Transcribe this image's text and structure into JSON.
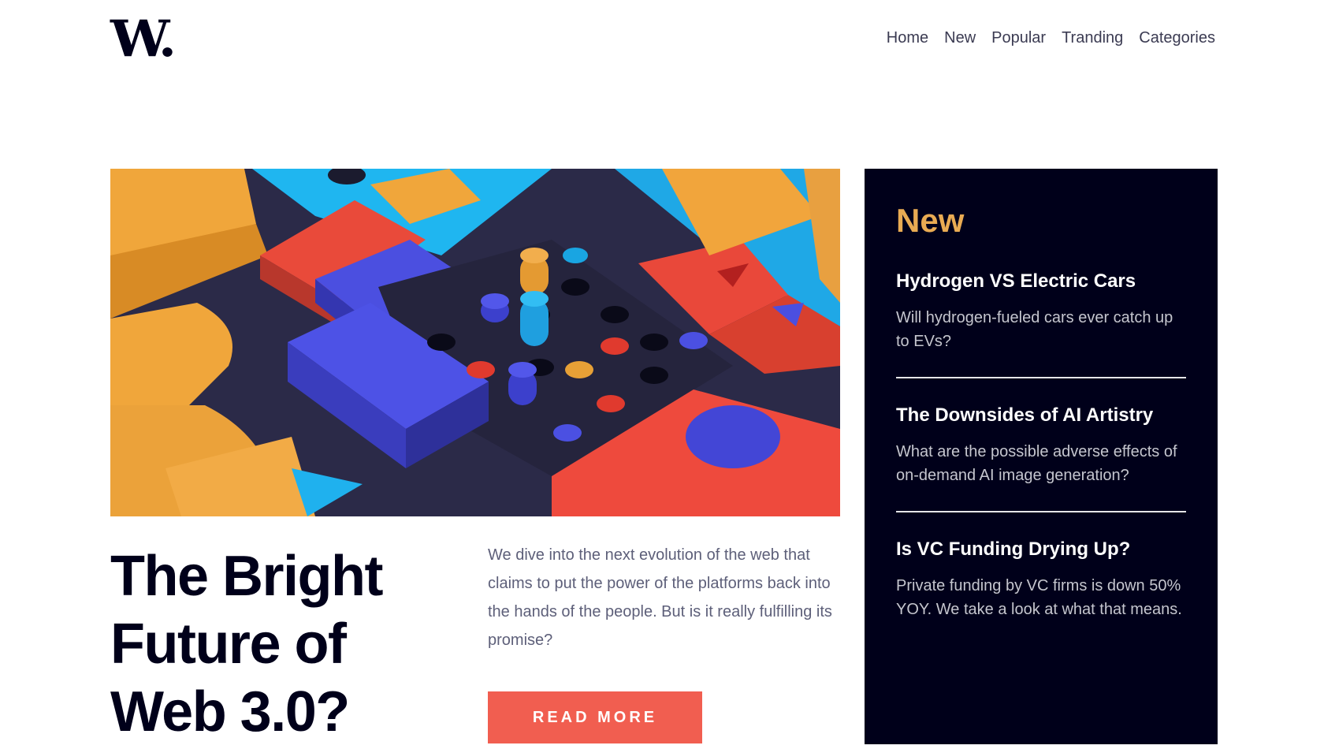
{
  "logo": "W.",
  "nav": {
    "items": [
      "Home",
      "New",
      "Popular",
      "Tranding",
      "Categories"
    ]
  },
  "hero": {
    "headline_lines": [
      "The Bright",
      "Future of",
      "Web 3.0?"
    ],
    "lead": "We dive into the next evolution of the web that claims to put the power of the platforms back into the hands of the people. But is it really fulfilling its promise?",
    "cta_label": "READ MORE"
  },
  "sidebar": {
    "title": "New",
    "items": [
      {
        "title": "Hydrogen VS Electric Cars",
        "summary": "Will hydrogen-fueled cars ever catch up to EVs?"
      },
      {
        "title": "The Downsides of AI Artistry",
        "summary": "What are the possible adverse effects of on-demand AI image generation?"
      },
      {
        "title": "Is VC Funding Drying Up?",
        "summary": "Private funding by VC firms is down 50% YOY. We take a look at what that means."
      }
    ]
  },
  "colors": {
    "accent_orange": "#e9ab53",
    "cta_red": "#f15e50",
    "dark_navy": "#00001a",
    "body_gray": "#5d5f79"
  }
}
